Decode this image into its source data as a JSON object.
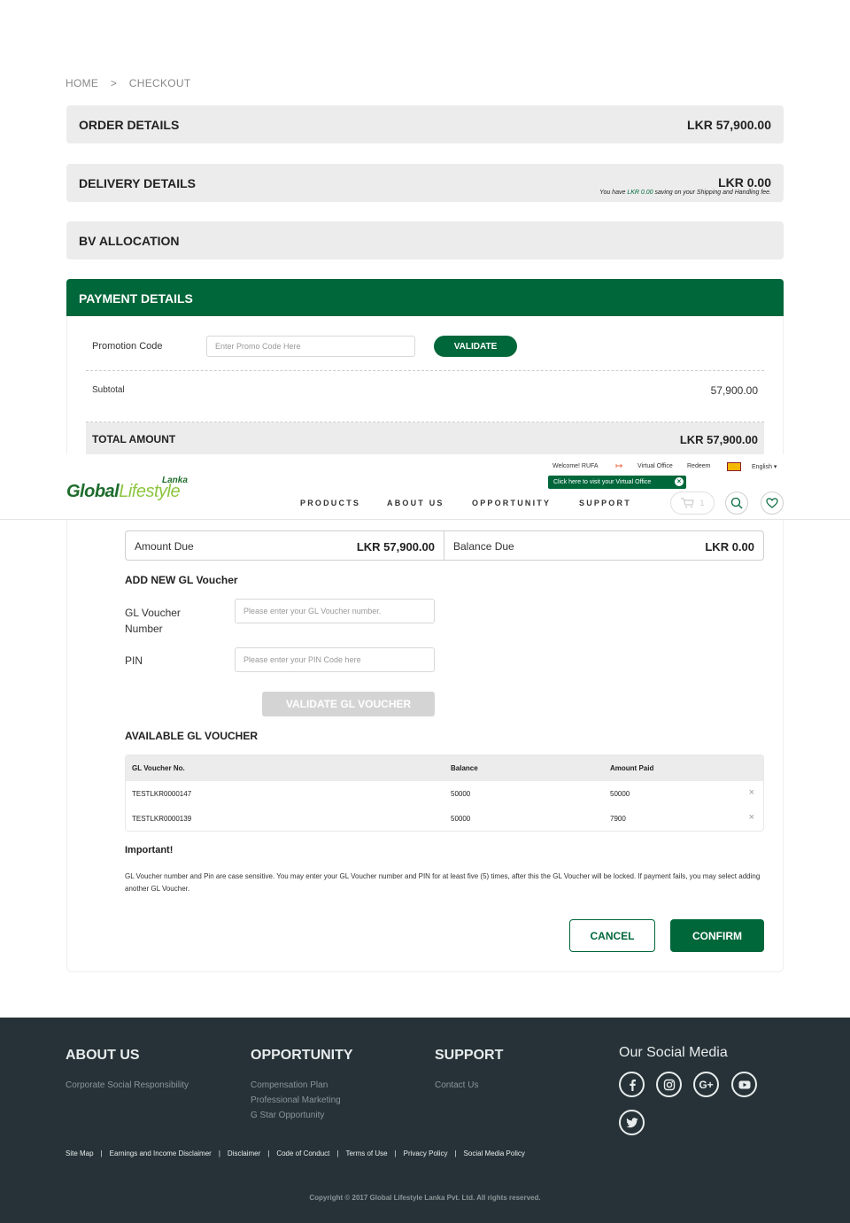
{
  "breadcrumb": {
    "home": "HOME",
    "separator": ">",
    "current": "CHECKOUT"
  },
  "order": {
    "title": "ORDER DETAILS",
    "amount": "LKR 57,900.00"
  },
  "delivery": {
    "title": "DELIVERY DETAILS",
    "amount": "LKR 0.00",
    "note_pre": "You have",
    "note_amount": "LKR 0.00",
    "note_post": "saving on your Shipping and Handling fee."
  },
  "bv": {
    "title": "BV ALLOCATION"
  },
  "payment": {
    "title": "PAYMENT DETAILS",
    "promo_label": "Promotion Code",
    "promo_placeholder": "Enter Promo Code Here",
    "validate_label": "VALIDATE",
    "subtotal_label": "Subtotal",
    "subtotal_value": "57,900.00",
    "total_label": "TOTAL AMOUNT",
    "total_value": "LKR 57,900.00"
  },
  "header": {
    "logo_main": "Global",
    "logo_italic": "Lifestyle",
    "logo_region": "Lanka",
    "welcome": "Welcome! RUFA",
    "virtual_office": "Virtual Office",
    "redeem": "Redeem",
    "language": "English",
    "tooltip": "Click here to visit your Virtual Office",
    "nav": [
      "PRODUCTS",
      "ABOUT US",
      "OPPORTUNITY",
      "SUPPORT"
    ],
    "cart_count": "1",
    "accent": "#00673a"
  },
  "amounts": {
    "due_label": "Amount Due",
    "due_value": "LKR 57,900.00",
    "balance_label": "Balance Due",
    "balance_value": "LKR 0.00"
  },
  "voucher_form": {
    "title": "ADD NEW GL Voucher",
    "number_label_1": "GL Voucher",
    "number_label_2": "Number",
    "number_placeholder": "Please enter your GL Voucher number.",
    "pin_label": "PIN",
    "pin_placeholder": "Please enter your PIN Code here",
    "validate_label": "VALIDATE GL VOUCHER"
  },
  "available": {
    "title": "AVAILABLE GL VOUCHER",
    "columns": [
      "GL Voucher No.",
      "Balance",
      "Amount Paid"
    ],
    "rows": [
      {
        "no": "TESTLKR0000147",
        "balance": "50000",
        "paid": "50000"
      },
      {
        "no": "TESTLKR0000139",
        "balance": "50000",
        "paid": "7900"
      }
    ],
    "remove_glyph": "×"
  },
  "important": {
    "title": "Important!",
    "text": "GL Voucher number and Pin are case sensitive. You may enter your GL Voucher number and PIN for at least five (5) times, after this the GL Voucher will be locked. If payment fails, you may select adding another GL Voucher."
  },
  "actions": {
    "cancel": "CANCEL",
    "confirm": "CONFIRM"
  },
  "footer": {
    "about_title": "ABOUT US",
    "about_links": [
      "Corporate Social Responsibility"
    ],
    "opportunity_title": "OPPORTUNITY",
    "opportunity_links": [
      "Compensation Plan",
      "Professional Marketing",
      "G Star Opportunity"
    ],
    "support_title": "SUPPORT",
    "support_links": [
      "Contact Us"
    ],
    "social_title": "Our Social Media",
    "social_icons": [
      "facebook-icon",
      "instagram-icon",
      "google-plus-icon",
      "youtube-icon",
      "twitter-icon"
    ],
    "bottom_links": [
      "Site Map",
      "Earnings and Income Disclaimer",
      "Disclaimer",
      "Code of Conduct",
      "Terms of Use",
      "Privacy Policy",
      "Social Media Policy"
    ],
    "bottom_separator": "|",
    "copyright": "Copyright © 2017 Global Lifestyle Lanka Pvt. Ltd. All rights reserved."
  }
}
